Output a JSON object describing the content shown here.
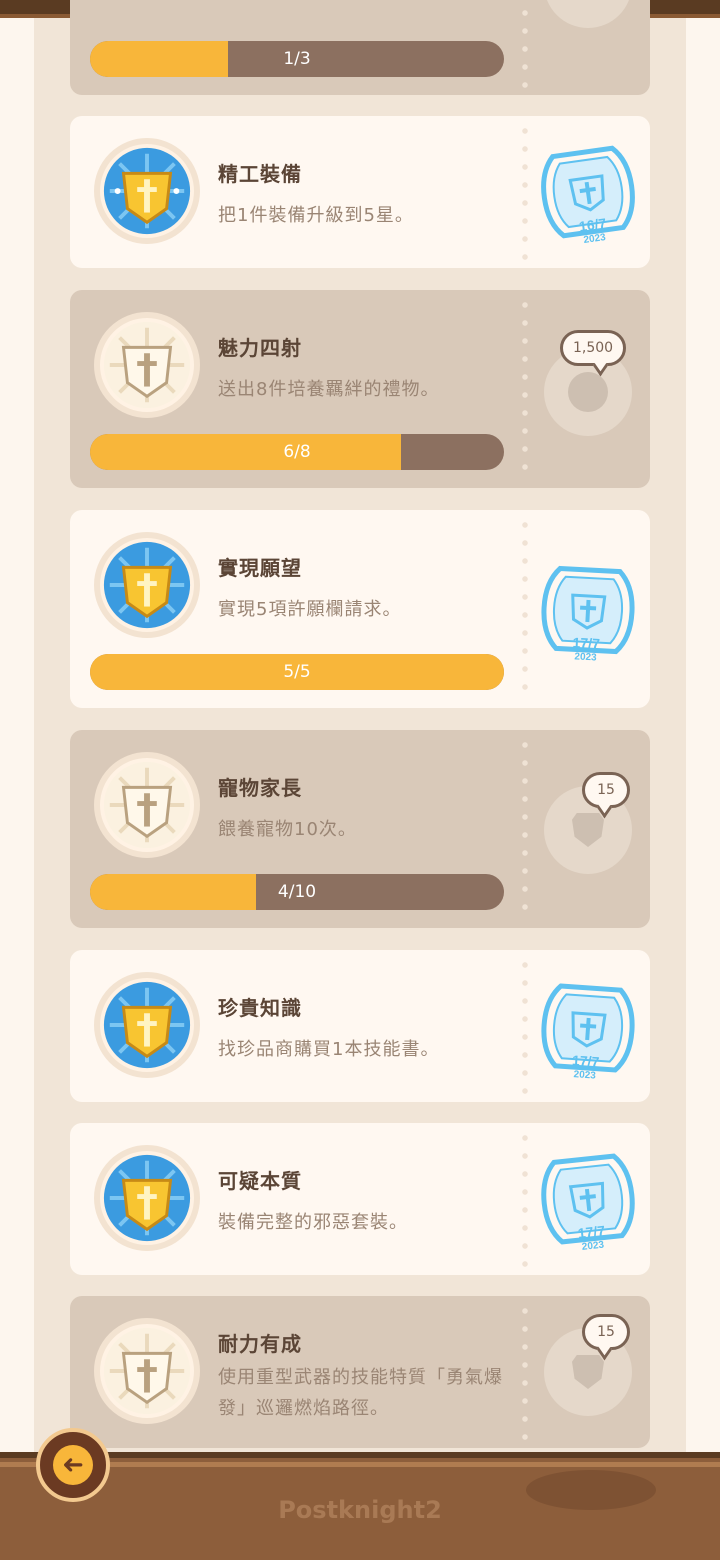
{
  "top_partial": {
    "progress_label": "1/3",
    "progress_fraction": 0.333
  },
  "achievements": [
    {
      "title": "精工裝備",
      "desc": "把1件裝備升級到5星。",
      "completed": true,
      "stamp_date": "16/7",
      "stamp_year": "2023"
    },
    {
      "title": "魅力四射",
      "desc": "送出8件培養羈絆的禮物。",
      "completed": false,
      "progress_label": "6/8",
      "progress_fraction": 0.75,
      "reward": "1,500",
      "reward_icon": "coin-icon"
    },
    {
      "title": "實現願望",
      "desc": "實現5項許願欄請求。",
      "completed": true,
      "progress_label": "5/5",
      "progress_fraction": 1.0,
      "stamp_date": "17/7",
      "stamp_year": "2023"
    },
    {
      "title": "寵物家長",
      "desc": "餵養寵物10次。",
      "completed": false,
      "progress_label": "4/10",
      "progress_fraction": 0.4,
      "reward": "15",
      "reward_icon": "shield-gem-icon"
    },
    {
      "title": "珍貴知識",
      "desc": "找珍品商購買1本技能書。",
      "completed": true,
      "stamp_date": "17/7",
      "stamp_year": "2023"
    },
    {
      "title": "可疑本質",
      "desc": "裝備完整的邪惡套裝。",
      "completed": true,
      "stamp_date": "17/7",
      "stamp_year": "2023"
    },
    {
      "title": "耐力有成",
      "desc": "使用重型武器的技能特質「勇氣爆發」巡邏燃焰路徑。",
      "completed": false,
      "reward": "15",
      "reward_icon": "shield-gem-icon"
    }
  ],
  "footer": {
    "logo": "Postknight2",
    "back_icon": "back-arrow-icon"
  },
  "colors": {
    "progress_fill": "#f8b63a",
    "progress_track": "#8c7060",
    "stamp_blue": "#5ec1f0",
    "card_completed": "#fff8f1",
    "card_incomplete": "#d9c9b9",
    "wood": "#8d5e3b"
  }
}
